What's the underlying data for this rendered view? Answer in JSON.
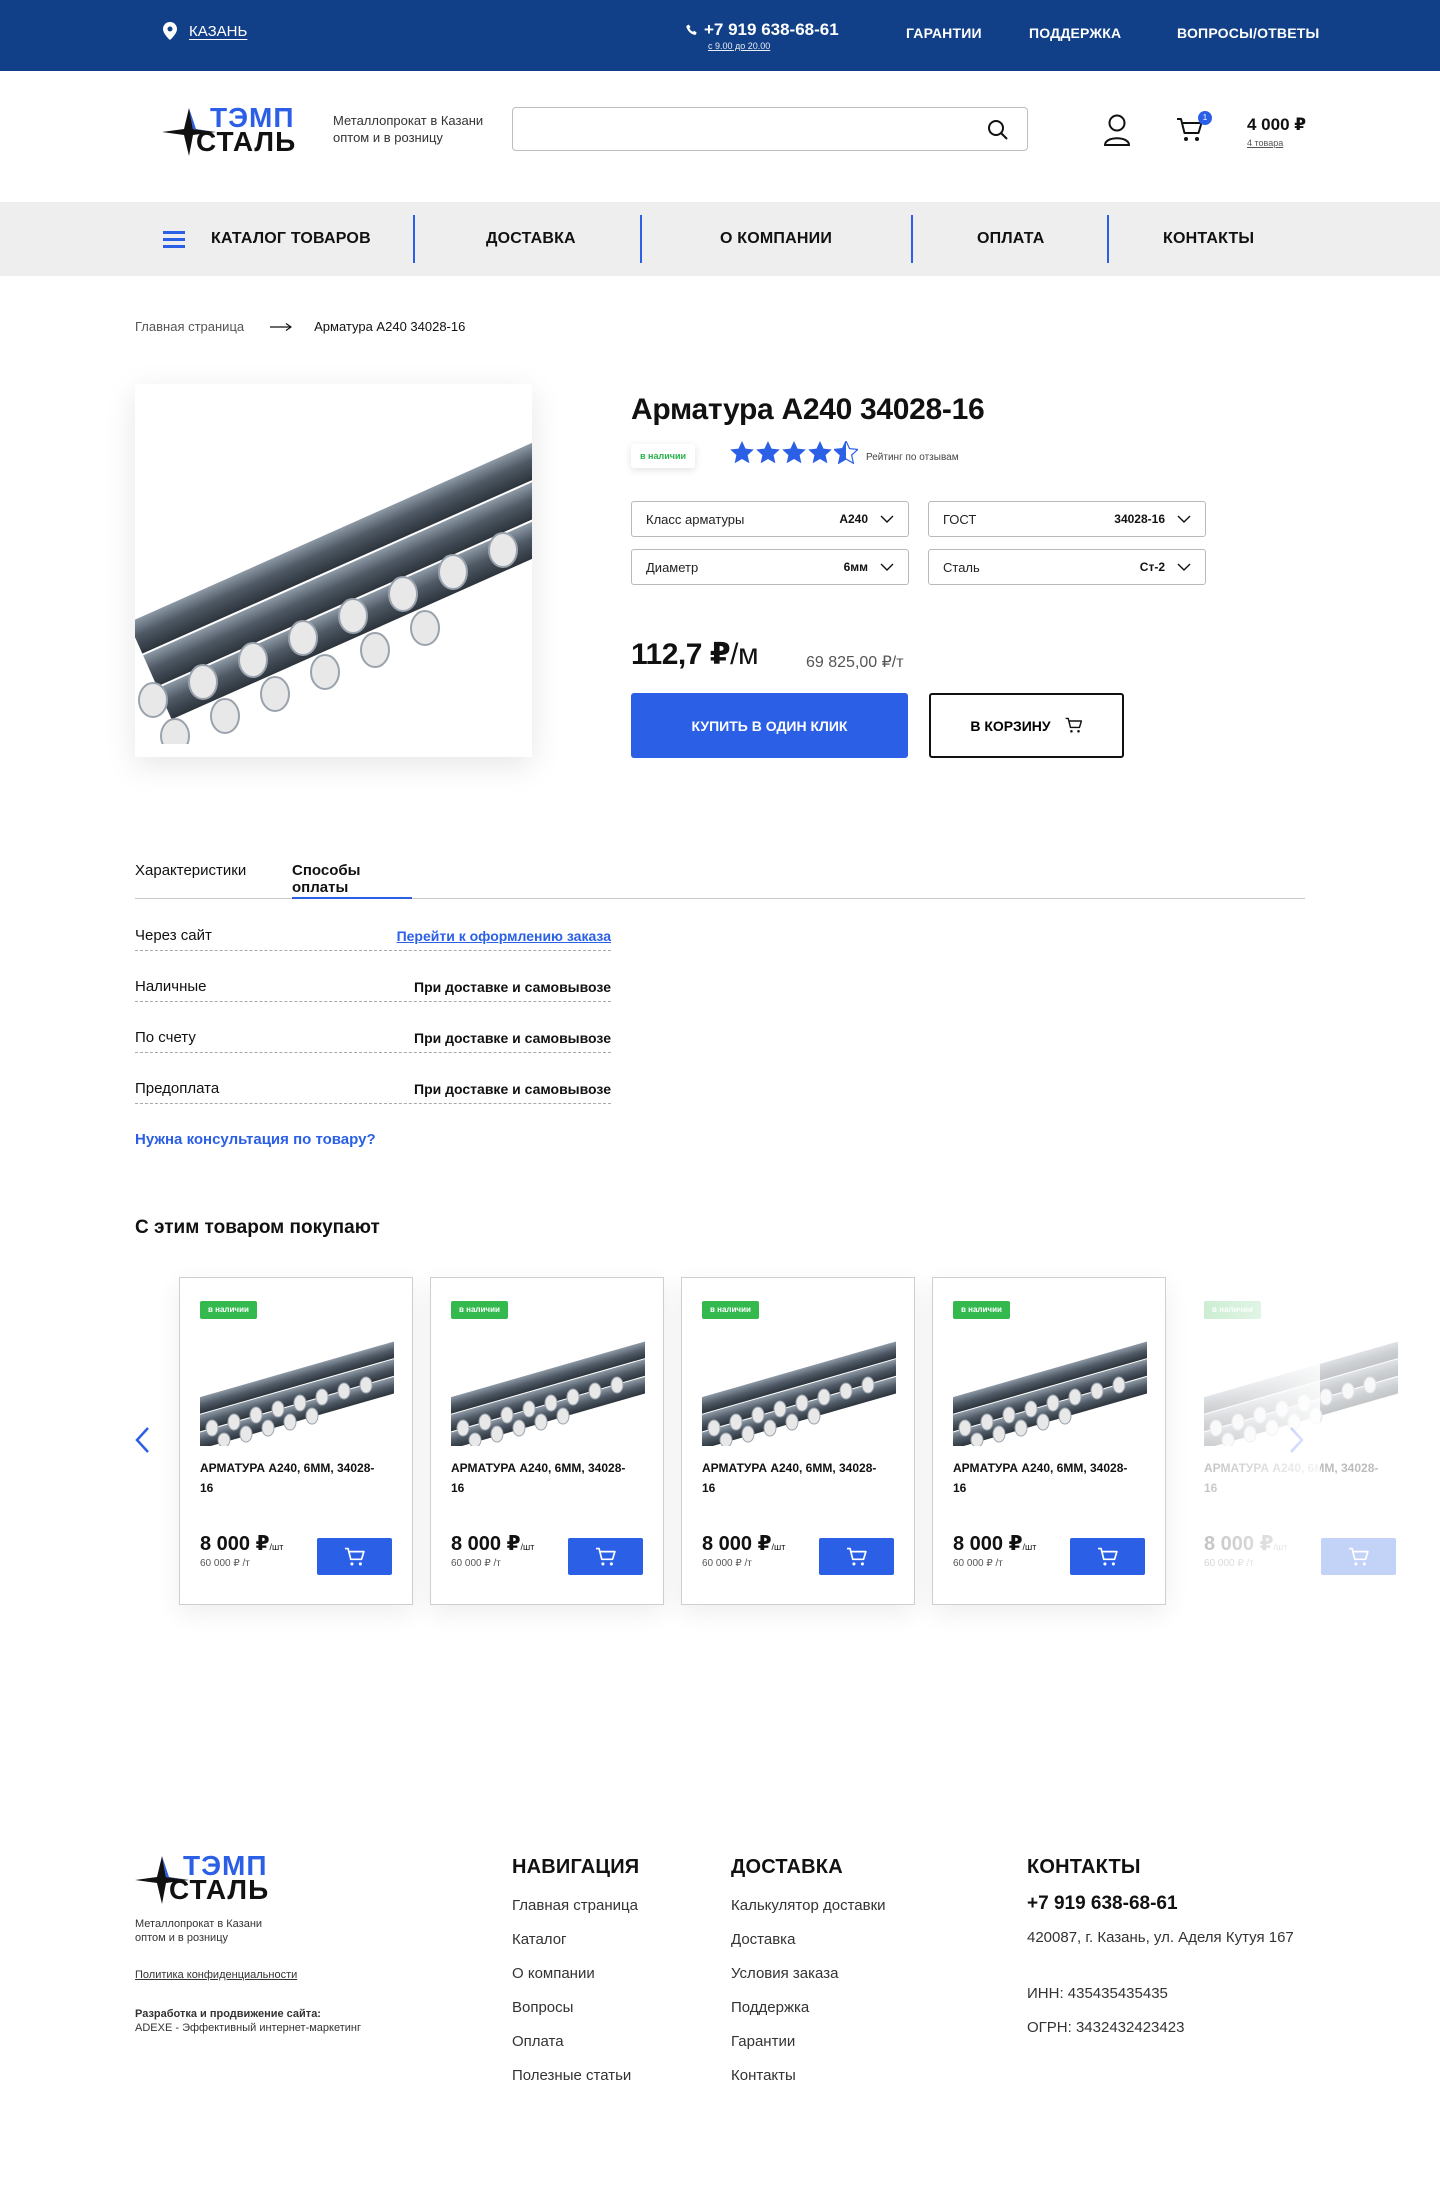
{
  "topbar": {
    "city": "КАЗАНЬ",
    "phone": "+7 919 638-68-61",
    "hours": "с 9.00 до 20.00",
    "links": [
      "ГАРАНТИИ",
      "ПОДДЕРЖКА",
      "ВОПРОСЫ/ОТВЕТЫ"
    ]
  },
  "brand": {
    "word1": "ТЭМП",
    "word2": "СТАЛЬ",
    "tagline_1": "Металлопрокат в Казани",
    "tagline_2": "оптом и в розницу",
    "accent_color": "#2a5fe6",
    "dark_blue": "#124088"
  },
  "header": {
    "search_placeholder": "",
    "cart_badge": "1",
    "cart_sum": "4 000 ₽",
    "cart_count": "4 товара"
  },
  "nav": {
    "catalog": "КАТАЛОГ ТОВАРОВ",
    "items": [
      "ДОСТАВКА",
      "О КОМПАНИИ",
      "ОПЛАТА",
      "КОНТАКТЫ"
    ]
  },
  "breadcrumb": {
    "home": "Главная страница",
    "current": "Арматура А240 34028-16"
  },
  "product": {
    "title": "Арматура А240 34028-16",
    "stock": "в наличии",
    "rating": 4.5,
    "rating_text": "Рейтинг по отзывам",
    "options": [
      {
        "label": "Класс арматуры",
        "value": "А240"
      },
      {
        "label": "ГОСТ",
        "value": "34028-16"
      },
      {
        "label": "Диаметр",
        "value": "6мм"
      },
      {
        "label": "Сталь",
        "value": "Ст-2"
      }
    ],
    "price": "112,7 ₽",
    "price_unit": "/м",
    "price_per_ton": "69 825,00 ₽/т",
    "buy_one_click": "КУПИТЬ В ОДИН КЛИК",
    "to_cart": "В КОРЗИНУ"
  },
  "tabs": {
    "items": [
      "Характеристики",
      "Способы оплаты"
    ],
    "active": 1
  },
  "payment": {
    "rows": [
      {
        "label": "Через сайт",
        "value": "Перейти к оформлению заказа"
      },
      {
        "label": "Наличные",
        "value": "При доставке и самовывозе"
      },
      {
        "label": "По счету",
        "value": "При доставке и самовывозе"
      },
      {
        "label": "Предоплата",
        "value": "При доставке и самовывозе"
      }
    ],
    "consult": "Нужна консультация по товару?"
  },
  "related": {
    "title": "С этим товаром покупают",
    "cards": [
      {
        "stock": "в наличии",
        "name": "АРМАТУРА А240, 6ММ, 34028-16",
        "price": "8 000 ₽",
        "unit": "/шт",
        "price_t": "60 000 ₽ /т"
      },
      {
        "stock": "в наличии",
        "name": "АРМАТУРА А240, 6ММ, 34028-16",
        "price": "8 000 ₽",
        "unit": "/шт",
        "price_t": "60 000 ₽ /т"
      },
      {
        "stock": "в наличии",
        "name": "АРМАТУРА А240, 6ММ, 34028-16",
        "price": "8 000 ₽",
        "unit": "/шт",
        "price_t": "60 000 ₽ /т"
      },
      {
        "stock": "в наличии",
        "name": "АРМАТУРА А240, 6ММ, 34028-16",
        "price": "8 000 ₽",
        "unit": "/шт",
        "price_t": "60 000 ₽ /т"
      },
      {
        "stock": "в наличии",
        "name": "АРМАТУРА А240, 6ММ, 34028-16",
        "price": "8 000 ₽",
        "unit": "/шт",
        "price_t": "60 000 ₽ /т"
      }
    ]
  },
  "footer": {
    "privacy": "Политика конфиденциальности",
    "dev_title": "Разработка и продвижение сайта:",
    "dev_text": "ADEXE - Эффективный интернет-маркетинг",
    "nav_title": "НАВИГАЦИЯ",
    "nav_links": [
      "Главная страница",
      "Каталог",
      "О компании",
      "Вопросы",
      "Оплата",
      "Полезные статьи"
    ],
    "delivery_title": "ДОСТАВКА",
    "delivery_links": [
      "Калькулятор доставки",
      "Доставка",
      "Условия заказа",
      "Поддержка",
      "Гарантии",
      "Контакты"
    ],
    "contacts_title": "КОНТАКТЫ",
    "phone": "+7 919 638-68-61",
    "address": "420087,  г. Казань, ул. Аделя Кутуя 167",
    "inn": "ИНН: 435435435435",
    "ogrn": "ОГРН: 3432432423423"
  }
}
